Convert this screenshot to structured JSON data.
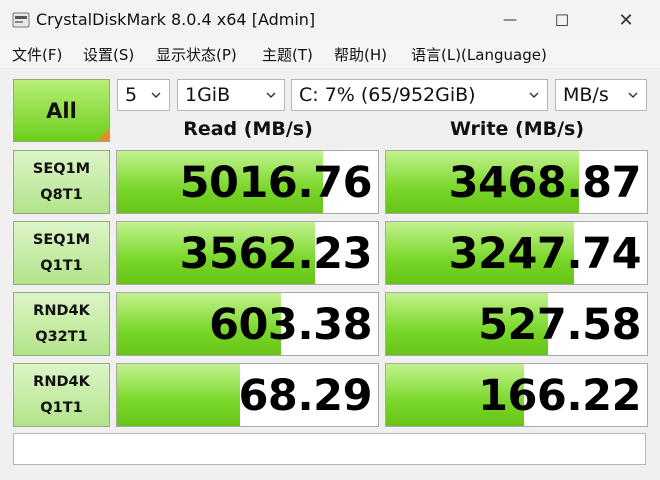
{
  "window": {
    "title": "CrystalDiskMark 8.0.4 x64 [Admin]",
    "minimize_symbol": "—",
    "maximize_symbol": "☐",
    "close_symbol": "✕"
  },
  "menu": [
    {
      "label": "文件(F)"
    },
    {
      "label": "设置(S)"
    },
    {
      "label": "显示状态(P)"
    },
    {
      "label": "主题(T)"
    },
    {
      "label": "帮助(H)"
    },
    {
      "label": "语言(L)(Language)"
    }
  ],
  "controls": {
    "all_label": "All",
    "count": "5",
    "size": "1GiB",
    "drive": "C: 7% (65/952GiB)",
    "unit": "MB/s"
  },
  "headers": {
    "read": "Read (MB/s)",
    "write": "Write (MB/s)"
  },
  "results": [
    {
      "line1": "SEQ1M",
      "line2": "Q8T1",
      "read": "5016.76",
      "write": "3468.87",
      "read_fill": 0.79,
      "write_fill": 0.74
    },
    {
      "line1": "SEQ1M",
      "line2": "Q1T1",
      "read": "3562.23",
      "write": "3247.74",
      "read_fill": 0.76,
      "write_fill": 0.72
    },
    {
      "line1": "RND4K",
      "line2": "Q32T1",
      "read": "603.38",
      "write": "527.58",
      "read_fill": 0.63,
      "write_fill": 0.62
    },
    {
      "line1": "RND4K",
      "line2": "Q1T1",
      "read": "68.29",
      "write": "166.22",
      "read_fill": 0.47,
      "write_fill": 0.53
    }
  ],
  "comment": "",
  "colors": {
    "bar_green": "#7ad72a",
    "all_button_green": "#6ece1c",
    "all_button_corner": "#f0882a"
  }
}
